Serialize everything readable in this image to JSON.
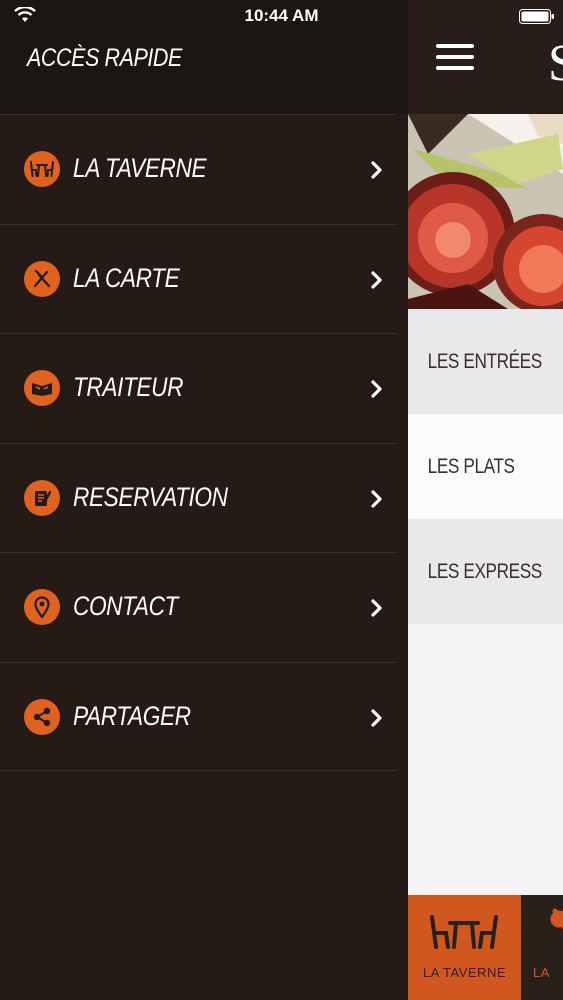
{
  "status_bar": {
    "time": "10:44 AM"
  },
  "drawer": {
    "title": "ACCÈS RAPIDE",
    "items": [
      {
        "label": "LA TAVERNE",
        "icon": "taverne-table-icon"
      },
      {
        "label": "LA CARTE",
        "icon": "fork-knife-icon"
      },
      {
        "label": "TRAITEUR",
        "icon": "catering-box-icon"
      },
      {
        "label": "RESERVATION",
        "icon": "clipboard-icon"
      },
      {
        "label": "CONTACT",
        "icon": "location-pin-icon"
      },
      {
        "label": "PARTAGER",
        "icon": "share-icon"
      }
    ]
  },
  "main": {
    "sections": [
      "LES ENTRÉES",
      "LES PLATS",
      "LES EXPRESS"
    ],
    "tabs": [
      {
        "label": "LA TAVERNE",
        "icon": "taverne-table-icon"
      },
      {
        "label": "LA",
        "icon": "fork-knife-icon"
      }
    ]
  },
  "colors": {
    "accent": "#e0621f",
    "drawer_bg": "#251a15",
    "header_bg": "#1b1513",
    "tab_active": "#d2571f"
  }
}
